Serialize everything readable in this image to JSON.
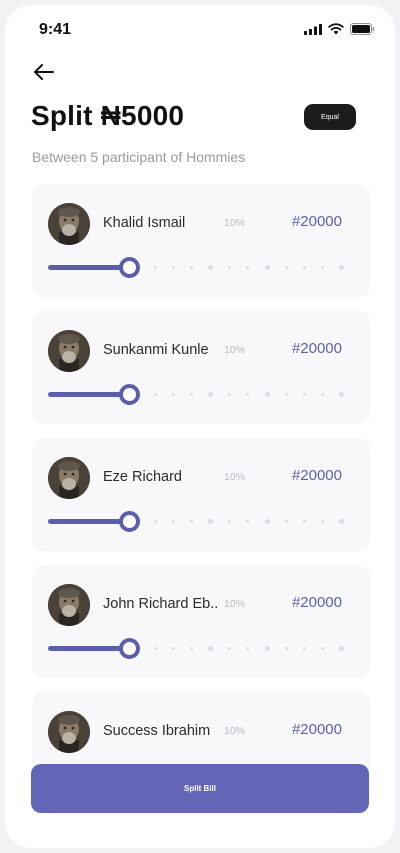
{
  "status_bar": {
    "time": "9:41"
  },
  "header": {
    "title": "Split ₦5000",
    "equal_label": "Equal",
    "subtitle": "Between 5 participant of Hommies"
  },
  "participants": [
    {
      "name": "Khalid Ismail",
      "percent": "10%",
      "amount": "#20000",
      "share": 0.28
    },
    {
      "name": "Sunkanmi Kunle",
      "percent": "10%",
      "amount": "#20000",
      "share": 0.28
    },
    {
      "name": "Eze Richard",
      "percent": "10%",
      "amount": "#20000",
      "share": 0.28
    },
    {
      "name": "John Richard Eb..",
      "percent": "10%",
      "amount": "#20000",
      "share": 0.28
    },
    {
      "name": "Success Ibrahim",
      "percent": "10%",
      "amount": "#20000",
      "share": 0.28
    }
  ],
  "footer": {
    "split_label": "Split Bill"
  },
  "colors": {
    "accent": "#6366b6",
    "slider": "#5b5ea8",
    "amount": "#5d5fa8"
  }
}
